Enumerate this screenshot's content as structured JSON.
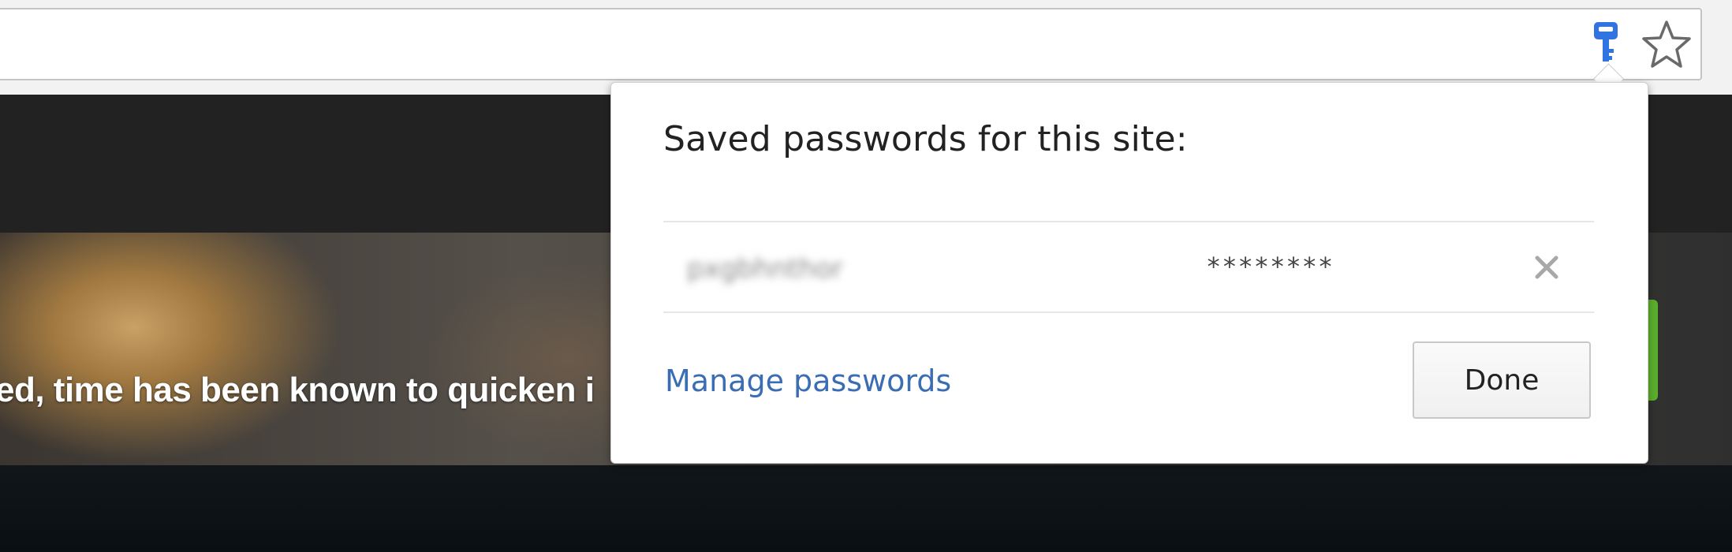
{
  "hero": {
    "text": "ed, time has been known to quicken i"
  },
  "password_bubble": {
    "title": "Saved passwords for this site:",
    "entry": {
      "username": "pxgbhnthor",
      "password": "********"
    },
    "manage_link": "Manage passwords",
    "done_button": "Done"
  },
  "icons": {
    "key": "key-icon",
    "star": "star-icon",
    "delete": "close-icon"
  },
  "colors": {
    "key_blue": "#2f74e0",
    "link_blue": "#3b6db3",
    "green_button": "#5cae2e"
  }
}
